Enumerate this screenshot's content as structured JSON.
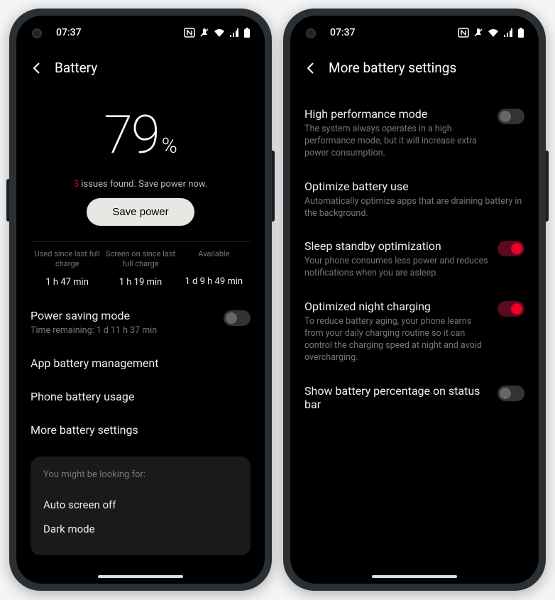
{
  "status": {
    "time": "07:37"
  },
  "colors": {
    "accent": "#eb0028"
  },
  "left": {
    "title": "Battery",
    "percent": "79",
    "percent_symbol": "%",
    "issues_count": "3",
    "issues_text": "issues found. Save power now.",
    "save_button": "Save power",
    "stats": [
      {
        "label": "Used since last full charge",
        "value": "1 h 47 min"
      },
      {
        "label": "Screen on since last full charge",
        "value": "1 h 19 min"
      },
      {
        "label": "Available",
        "value": "1 d 9 h 49 min"
      }
    ],
    "rows": [
      {
        "title": "Power saving mode",
        "sub": "Time remaining:  1 d 11 h 37 min",
        "toggle": false
      },
      {
        "title": "App battery management"
      },
      {
        "title": "Phone battery usage"
      },
      {
        "title": "More battery settings"
      }
    ],
    "suggest_header": "You might be looking for:",
    "suggest_items": [
      "Auto screen off",
      "Dark mode"
    ]
  },
  "right": {
    "title": "More battery settings",
    "rows": [
      {
        "title": "High performance mode",
        "sub": "The system always operates in a high performance mode, but it will increase extra power consumption.",
        "toggle": false,
        "toggle_on": false
      },
      {
        "title": "Optimize battery use",
        "sub": "Automatically optimize apps that are draining battery in the background."
      },
      {
        "title": "Sleep standby optimization",
        "sub": "Your phone consumes less power and reduces notifications when you are asleep.",
        "toggle": true,
        "toggle_on": true
      },
      {
        "title": "Optimized night charging",
        "sub": "To reduce battery aging, your phone learns from your daily charging routine so it can control the charging speed at night and avoid overcharging.",
        "toggle": true,
        "toggle_on": true
      },
      {
        "title": "Show battery percentage on status bar",
        "toggle": true,
        "toggle_on": false
      }
    ]
  }
}
